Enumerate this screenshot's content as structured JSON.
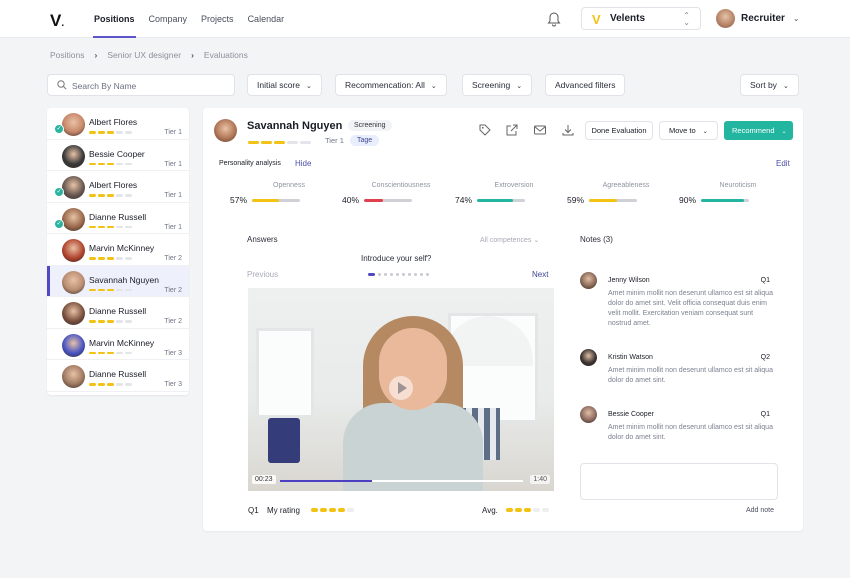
{
  "nav": {
    "logo": "V",
    "items": [
      {
        "label": "Positions",
        "active": true
      },
      {
        "label": "Company",
        "active": false
      },
      {
        "label": "Projects",
        "active": false
      },
      {
        "label": "Calendar",
        "active": false
      }
    ],
    "org_name": "Velents",
    "user_name": "Recruiter",
    "icons": {
      "bell": "bell-icon",
      "chevron": "chevron-down-icon",
      "org_switch": "chevron-up-down-icon"
    }
  },
  "breadcrumb": [
    "Positions",
    "Senior UX designer",
    "Evaluations"
  ],
  "toolbar": {
    "search_placeholder": "Search By Name",
    "filters": [
      "Initial score",
      "Recommencation: All",
      "Screening"
    ],
    "advanced_filters": "Advanced filters",
    "sort_by": "Sort by"
  },
  "candidates": [
    {
      "name": "Albert Flores",
      "tier": "Tier 1",
      "rating": 3,
      "checked": true,
      "avatar_color": "#c8876a"
    },
    {
      "name": "Bessie Cooper",
      "tier": "Tier 1",
      "rating": 3,
      "checked": false,
      "avatar_color": "#3a3a3a"
    },
    {
      "name": "Albert Flores",
      "tier": "Tier 1",
      "rating": 3,
      "checked": true,
      "avatar_color": "#6a5a52"
    },
    {
      "name": "Dianne Russell",
      "tier": "Tier 1",
      "rating": 3,
      "checked": true,
      "avatar_color": "#9b6a4d"
    },
    {
      "name": "Marvin McKinney",
      "tier": "Tier 2",
      "rating": 3,
      "checked": false,
      "avatar_color": "#b2452f"
    },
    {
      "name": "Savannah Nguyen",
      "tier": "Tier 2",
      "rating": 3,
      "checked": false,
      "avatar_color": "#b98d72",
      "active": true
    },
    {
      "name": "Dianne Russell",
      "tier": "Tier 2",
      "rating": 3,
      "checked": false,
      "avatar_color": "#7a5140"
    },
    {
      "name": "Marvin McKinney",
      "tier": "Tier 3",
      "rating": 3,
      "checked": false,
      "avatar_color": "#4a55c4"
    },
    {
      "name": "Dianne Russell",
      "tier": "Tier 3",
      "rating": 3,
      "checked": false,
      "avatar_color": "#a07a62"
    }
  ],
  "profile": {
    "name": "Savannah Nguyen",
    "status_badge": "Screening",
    "tier": "Tier 1",
    "tag": "Tage",
    "rating": 3,
    "rating_max": 5,
    "actions": {
      "icons": [
        "tag-icon",
        "external-link-icon",
        "mail-icon",
        "download-icon"
      ],
      "done_evaluation": "Done Evaluation",
      "move_to": "Move to",
      "recommend": "Recommend"
    }
  },
  "personality": {
    "label": "Personality analysis",
    "hide": "Hide",
    "edit": "Edit",
    "traits": [
      {
        "name": "Openness",
        "percent": 57,
        "label": "57%",
        "color": "#f2c314"
      },
      {
        "name": "Conscientiousness",
        "percent": 40,
        "label": "40%",
        "color": "#e0404e"
      },
      {
        "name": "Extroversion",
        "percent": 74,
        "label": "74%",
        "color": "#22b5a0"
      },
      {
        "name": "Agreeableness",
        "percent": 59,
        "label": "59%",
        "color": "#f2c314"
      },
      {
        "name": "Neuroticism",
        "percent": 90,
        "label": "90%",
        "color": "#22b5a0"
      }
    ]
  },
  "answers": {
    "title": "Answers",
    "filter": "All competences",
    "question": "Introduce your self?",
    "previous": "Previous",
    "next": "Next",
    "page_current": 1,
    "page_total": 10,
    "video": {
      "current_time": "00:23",
      "duration": "1:40",
      "progress": 0.38
    },
    "q_label": "Q1",
    "my_rating_label": "My rating",
    "my_rating": 4,
    "avg_label": "Avg.",
    "avg_rating": 3,
    "rating_max": 5
  },
  "notes": {
    "title": "Notes (3)",
    "items": [
      {
        "author": "Jenny Wilson",
        "question": "Q1",
        "text": "Amet minim mollit non deserunt ullamco est sit aliqua dolor do amet sint. Velit officia consequat duis enim velit mollit. Exercitation veniam consequat sunt nostrud amet.",
        "avatar_color": "#8a6a58"
      },
      {
        "author": "Kristin Watson",
        "question": "Q2",
        "text": "Amet minim mollit non deserunt ullamco est sit aliqua dolor do amet sint.",
        "avatar_color": "#3b3431"
      },
      {
        "author": "Bessie Cooper",
        "question": "Q1",
        "text": "Amet minim mollit non deserunt ullamco est sit aliqua dolor do amet sint.",
        "avatar_color": "#8e6b60"
      }
    ],
    "input_placeholder": "",
    "add_note": "Add note"
  }
}
